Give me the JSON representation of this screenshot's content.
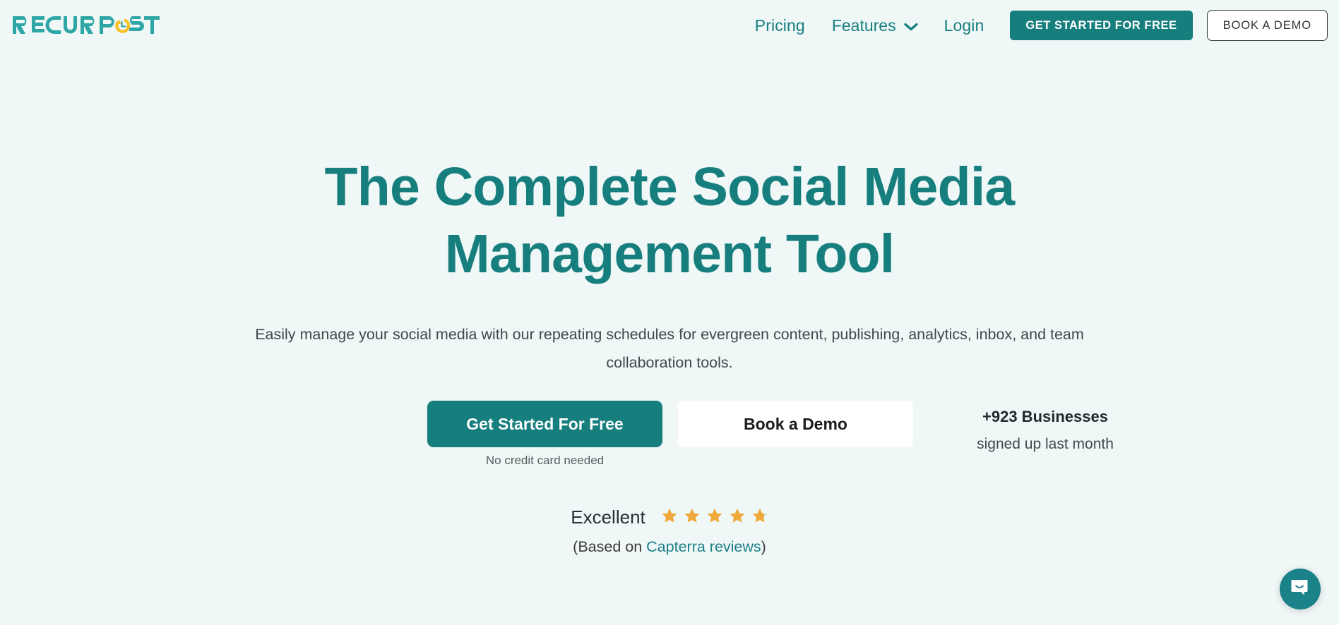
{
  "brand": {
    "logo_text": "RECURPOST",
    "logo_icon": "clock-refresh-icon",
    "teal": "#177e7e",
    "yellow": "#f6c223",
    "page_background": "#f0f7f7",
    "star_color": "#f0a93b"
  },
  "header": {
    "nav_links": [
      {
        "label": "Pricing",
        "name": "nav-link-pricing"
      },
      {
        "label": "Login",
        "name": "nav-link-login"
      }
    ],
    "features_dropdown": {
      "label": "Features",
      "icon": "chevron-down-icon"
    },
    "pricing_label": "Pricing",
    "login_label": "Login",
    "cta_primary": "GET STARTED FOR FREE",
    "cta_secondary": "BOOK A DEMO"
  },
  "hero": {
    "title_line1": "The Complete Social Media",
    "title_line2": "Management Tool",
    "subtitle": "Easily manage your social media with our repeating schedules for evergreen content, publishing, analytics, inbox, and team collaboration tools.",
    "cta_primary": "Get Started For Free",
    "cta_secondary": "Book a Demo",
    "no_card_note": "No credit card needed",
    "businesses_count": "+923 Businesses",
    "businesses_sub": "signed up last month"
  },
  "rating": {
    "word": "Excellent",
    "stars_total": 5,
    "stars_filled": 4,
    "last_star_fill_percent": 80,
    "caption_prefix": "(Based on ",
    "caption_link": "Capterra reviews",
    "caption_suffix": ")"
  },
  "chat": {
    "launcher_icon": "chat-bubble-smile-icon"
  }
}
